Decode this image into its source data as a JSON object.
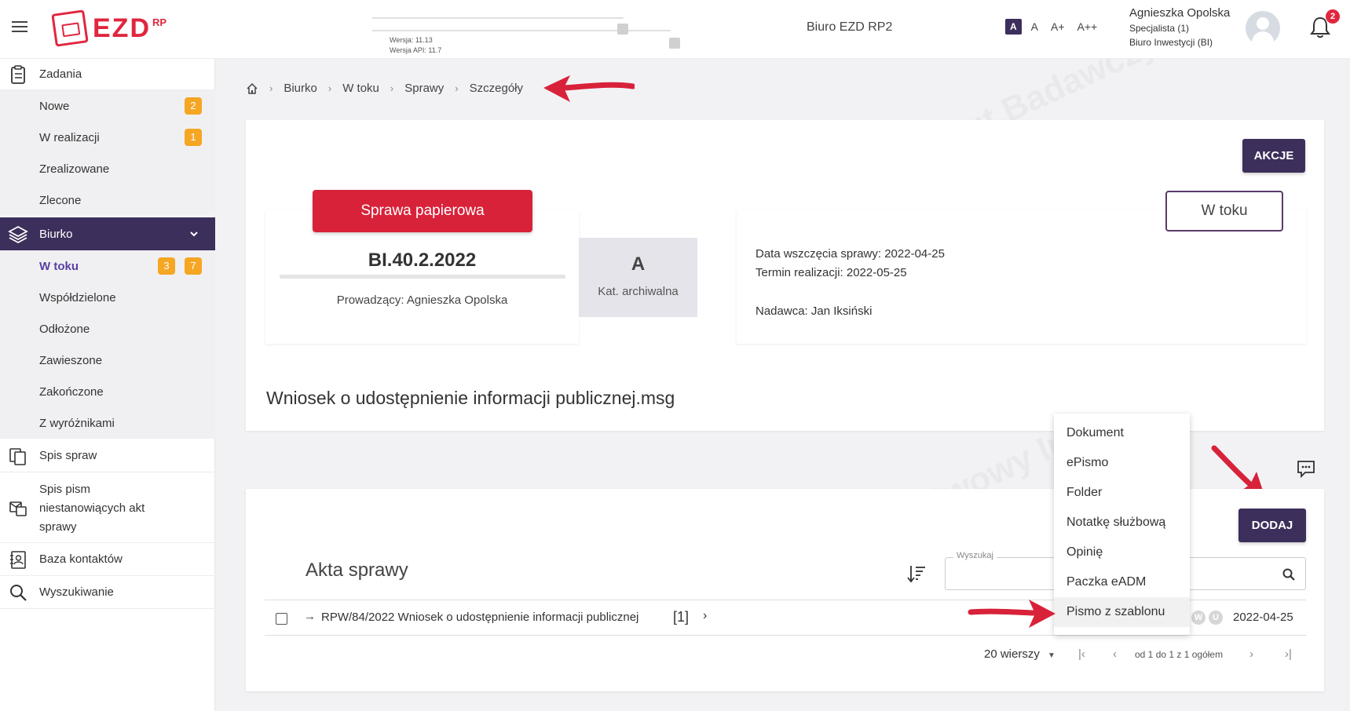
{
  "header": {
    "logo_text": "EZD",
    "logo_sup": "RP",
    "version": "Wersja: 11.13",
    "api_version": "Wersja API: 11.7",
    "office": "Biuro EZD RP2",
    "font_sizes": [
      "A",
      "A",
      "A+",
      "A++"
    ],
    "user_name": "Agnieszka Opolska",
    "user_role": "Specjalista (1)",
    "user_dept": "Biuro Inwestycji (BI)",
    "notifications": "2"
  },
  "sidebar": {
    "zadania": "Zadania",
    "nowe": "Nowe",
    "nowe_count": "2",
    "w_realizacji": "W realizacji",
    "w_realizacji_count": "1",
    "zrealizowane": "Zrealizowane",
    "zlecone": "Zlecone",
    "biurko": "Biurko",
    "w_toku": "W toku",
    "w_toku_count1": "3",
    "w_toku_count2": "7",
    "wspoldzielone": "Współdzielone",
    "odlozone": "Odłożone",
    "zawieszone": "Zawieszone",
    "zakonczone": "Zakończone",
    "z_wyroznikami": "Z wyróżnikami",
    "spis_spraw": "Spis spraw",
    "spis_pism_1": "Spis pism",
    "spis_pism_2": "niestanowiących akt",
    "spis_pism_3": "sprawy",
    "baza_kontaktow": "Baza kontaktów",
    "wyszukiwanie": "Wyszukiwanie"
  },
  "breadcrumb": {
    "items": [
      "Biurko",
      "W toku",
      "Sprawy",
      "Szczegóły"
    ]
  },
  "case": {
    "akcje": "AKCJE",
    "type_label": "Sprawa papierowa",
    "number": "BI.40.2.2022",
    "lead": "Prowadzący: Agnieszka Opolska",
    "archive_cat": "A",
    "archive_label": "Kat. archiwalna",
    "status": "W toku",
    "start_date": "Data wszczęcia sprawy:  2022-04-25",
    "deadline": "Termin realizacji:  2022-05-25",
    "sender": "Nadawca: Jan Iksiński",
    "title": "Wniosek o udostępnienie informacji publicznej.msg"
  },
  "akta": {
    "title": "Akta sprawy",
    "search_label": "Wyszukaj",
    "dodaj": "DODAJ",
    "row_text": "RPW/84/2022 Wniosek o udostępnienie informacji publicznej",
    "row_count": "[1]",
    "row_date": "2022-04-25",
    "row_badges": [
      "W",
      "U"
    ],
    "pagination_rows": "20 wierszy",
    "pagination_info": "od 1 do 1 z 1 ogółem"
  },
  "dropdown": {
    "items": [
      "Dokument",
      "ePismo",
      "Folder",
      "Notatkę służbową",
      "Opinię",
      "Paczka eADM",
      "Pismo z szablonu"
    ]
  },
  "colors": {
    "accent": "#3d2f5b",
    "brand_red": "#d8223a",
    "badge": "#f5a623"
  }
}
